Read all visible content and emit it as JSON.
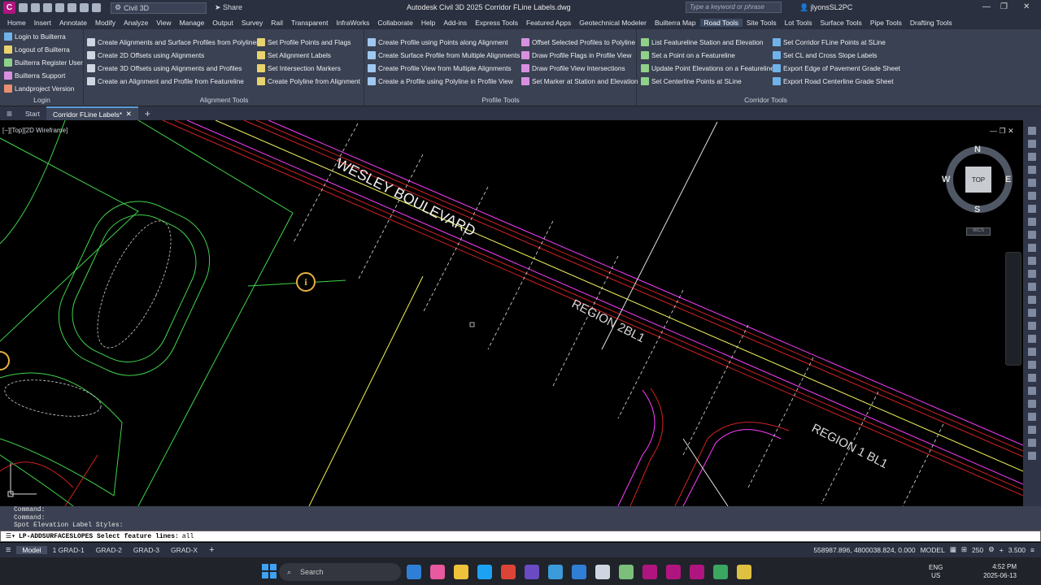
{
  "app": {
    "workspace": "Civil 3D",
    "share_label": "Share",
    "window_title": "Autodesk Civil 3D 2025    Corridor FLine Labels.dwg",
    "search_placeholder": "Type a keyword or phrase",
    "user": "jlyonsSL2PC"
  },
  "menu_tabs": [
    "Home",
    "Insert",
    "Annotate",
    "Modify",
    "Analyze",
    "View",
    "Manage",
    "Output",
    "Survey",
    "Rail",
    "Transparent",
    "InfraWorks",
    "Collaborate",
    "Help",
    "Add-ins",
    "Express Tools",
    "Featured Apps",
    "Geotechnical Modeler",
    "Builterra Map",
    "Road Tools",
    "Site Tools",
    "Lot Tools",
    "Surface Tools",
    "Pipe Tools",
    "Drafting Tools"
  ],
  "active_menu_tab": "Road Tools",
  "ribbon": {
    "login_items": [
      "Login to Builterra",
      "Logout of Builterra",
      "Builterra Register User",
      "Builterra Support",
      "Landproject Version"
    ],
    "login_title": "Login",
    "alignment_col1": [
      "Create Alignments and Surface Profiles from Polylines",
      "Create 2D Offsets using Alignments",
      "Create 3D Offsets using Alignments and Profiles",
      "Create an Alignment and Profile from Featureline"
    ],
    "alignment_col2": [
      "Set Profile Points and Flags",
      "Set Alignment Labels",
      "Set Intersection Markers",
      "Create Polyline from Alignment"
    ],
    "alignment_title": "Alignment Tools",
    "profile_col1": [
      "Create Profile using Points along Alignment",
      "Create Surface Profile from Multiple Alignments",
      "Create Profile View from Multiple Alignments",
      "Create a Profile using Polyline in Profile View"
    ],
    "profile_col2": [
      "Offset Selected Profiles to Polyline",
      "Draw Profile Flags in Profile View",
      "Draw Profile View Intersections",
      "Set Marker at Station and Elevation"
    ],
    "profile_title": "Profile Tools",
    "corridor_col1": [
      "List Featureline Station and Elevation",
      "Set a Point on a Featureline",
      "Update Point Elevations on a Featureline",
      "Set Centerline Points at SLine"
    ],
    "corridor_col2": [
      "Set Corridor FLine Points at SLine",
      "Set CL and Cross Slope Labels",
      "Export Edge of Pavement Grade Sheet",
      "Export Road Centerline Grade Sheet"
    ],
    "corridor_title": "Corridor Tools"
  },
  "doc_tabs": [
    "Start",
    "Corridor FLine Labels*"
  ],
  "viewport": {
    "label": "[−][Top][2D Wireframe]",
    "street_label": "WESLEY BOULEVARD",
    "region2": "REGION 2BL1",
    "region1": "REGION 1 BL1",
    "viewcube": {
      "n": "N",
      "s": "S",
      "e": "E",
      "w": "W",
      "top": "TOP",
      "wcs": "WCS"
    }
  },
  "command": {
    "history": [
      "Command:",
      "Command:",
      "Spot Elevation Label Styles:"
    ],
    "prompt": "LP-ADDSURFACESLOPES Select feature lines:",
    "value": "all"
  },
  "layout_tabs": [
    "Model",
    "1 GRAD-1",
    "GRAD-2",
    "GRAD-3",
    "GRAD-X"
  ],
  "status": {
    "coords": "558987.896, 4800038.824, 0.000",
    "space": "MODEL",
    "scale": "250",
    "annoscale": "3.500"
  },
  "taskbar": {
    "search": "Search",
    "lang": "ENG",
    "region": "US",
    "time": "4:52 PM",
    "date": "2025-06-13"
  },
  "colors": {
    "ribbon_bg": "#3a4152",
    "title_bg": "#2b3040",
    "green": "#3fd44a",
    "magenta": "#ff3cff",
    "red": "#d22222",
    "yellow": "#f2f25a"
  }
}
